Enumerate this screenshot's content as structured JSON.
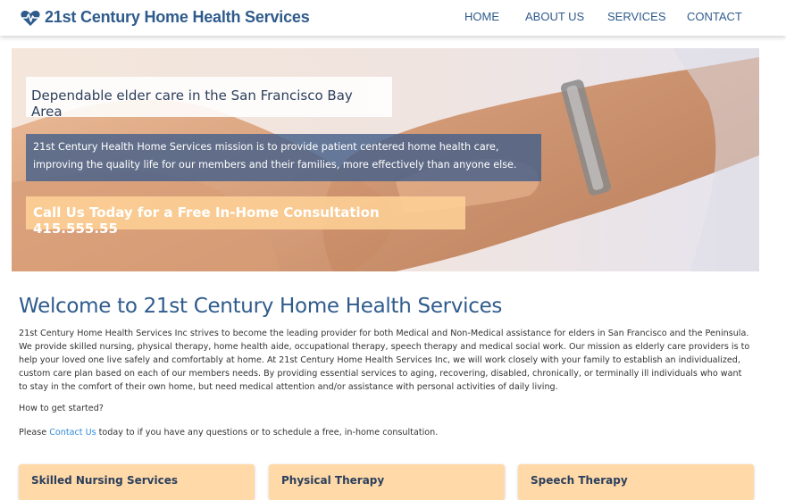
{
  "brand": {
    "name": "21st Century Home Health Services",
    "icon": "heart-pulse-icon",
    "color": "#2f5b8c"
  },
  "nav": {
    "items": [
      "HOME",
      "ABOUT US",
      "SERVICES",
      "CONTACT"
    ]
  },
  "hero": {
    "tagline": "Dependable elder care in the San Francisco Bay Area",
    "mission": "21st Century Health Home Services mission is to provide patient centered home health care, improving the quality life for our members and their families, more effectively than anyone else.",
    "cta": "Call Us Today for a Free In-Home Consultation 415.555.55"
  },
  "main": {
    "heading": "Welcome to 21st Century Home Health Services",
    "intro": "21st Century Home Health Services Inc strives to become the leading provider for both Medical and Non-Medical assistance for elders in San Francisco and the Peninsula. We provide skilled nursing, physical therapy, home health aide, occupational therapy, speech therapy and medical social work. Our mission as elderly care providers is to help your loved one live safely and comfortably at home. At 21st Century Home Health Services Inc, we will work closely with your family to establish an individualized, custom care plan based on each of our members needs. By providing essential services to aging, recovering, disabled, chronically, or terminally ill individuals who want to stay in the comfort of their own home, but need medical attention and/or assistance with personal activities of daily living.",
    "how_to": "How to get started?",
    "please": "Please",
    "contact_link": "Contact Us",
    "please_rest": "today to if you have any questions or to schedule a free, in-home consultation."
  },
  "cards": [
    {
      "title": "Skilled Nursing Services"
    },
    {
      "title": "Physical Therapy"
    },
    {
      "title": "Speech Therapy"
    }
  ],
  "colors": {
    "accent": "#2f5b8c",
    "link": "#2f8ad8",
    "card": "#ffd9a8",
    "mission_bg": "#46608a"
  }
}
